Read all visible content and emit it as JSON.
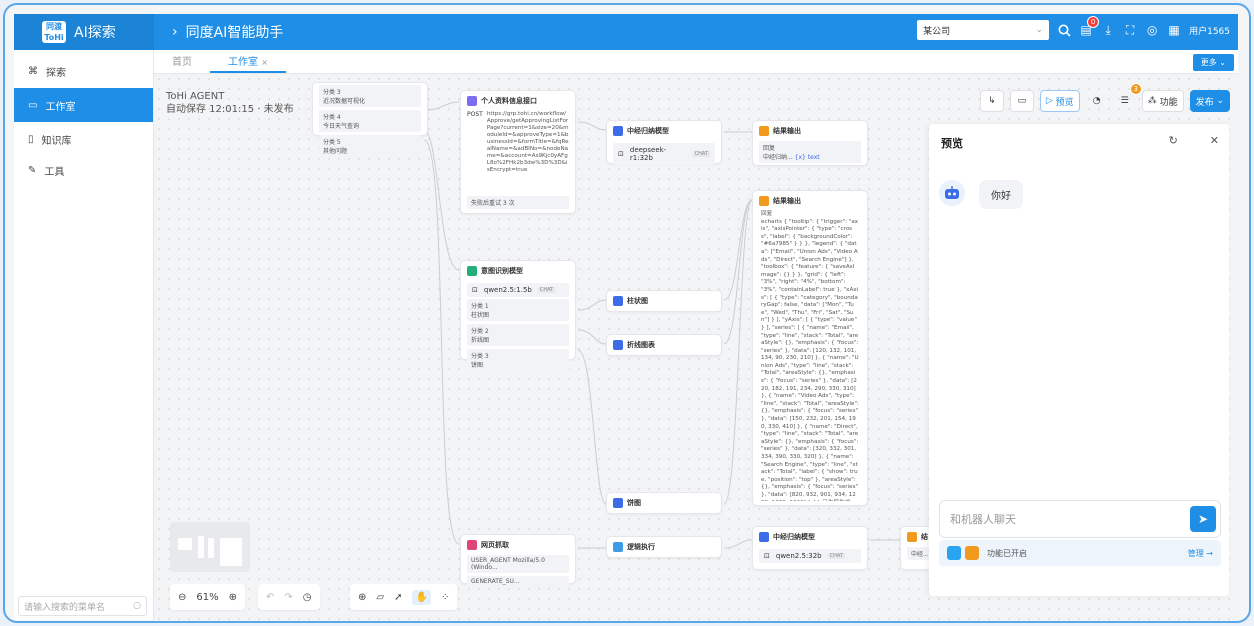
{
  "app": {
    "brand": "AI探索",
    "title": "同度AI智能助手",
    "company": "某公司",
    "user": "用户1565",
    "notif_count": "0",
    "logo_lines": [
      "同",
      "渡",
      "To",
      "Hi"
    ]
  },
  "sidebar": {
    "items": [
      {
        "label": "探索"
      },
      {
        "label": "工作室"
      },
      {
        "label": "知识库"
      },
      {
        "label": "工具"
      }
    ],
    "search_placeholder": "请输入搜索的菜单名"
  },
  "tabs": [
    {
      "label": "首页"
    },
    {
      "label": "工作室"
    }
  ],
  "tab_close": "×",
  "more_label": "更多",
  "agent": {
    "name": "ToHi AGENT",
    "status": "自动保存 12:01:15 · 未发布"
  },
  "toolbar": {
    "preview": "预览",
    "features": "功能",
    "publish": "发布",
    "alert_count": "3"
  },
  "nodes": {
    "branch_top": {
      "rows": [
        {
          "label": "分类 3",
          "value": "近况数据可视化"
        },
        {
          "label": "分类 4",
          "value": "今日天气查询"
        },
        {
          "label": "分类 5",
          "value": "其他问题"
        }
      ]
    },
    "http": {
      "title": "个人资料信息接口",
      "method": "POST",
      "url": "https://grp.tohi.cn/workflow/Approve/getApprovingListForPage?current=1&size=20&moduleId=&approveType=1&businessId=&formTitle=&fqRealName=&adBINo=&nodeName=&account=As9Kjc0yAFgL8o%2FHk2b3dw%3D%3D&isEncrypt=true",
      "retry": "失败后重试 3 次"
    },
    "llm1": {
      "title": "中经归纳模型",
      "model": "deepseek-r1:32b",
      "tag": "CHAT"
    },
    "out1": {
      "title": "结果输出",
      "label": "回复",
      "value": "中经归纳...",
      "var": "{x} text"
    },
    "intent": {
      "title": "意图识别模型",
      "model": "qwen2.5:1.5b",
      "tag": "CHAT",
      "rows": [
        {
          "label": "分类 1",
          "value": "柱状图"
        },
        {
          "label": "分类 2",
          "value": "折线图"
        },
        {
          "label": "分类 3",
          "value": "饼图"
        }
      ]
    },
    "bar": {
      "title": "柱状图"
    },
    "line": {
      "title": "折线图表"
    },
    "pie": {
      "title": "饼图"
    },
    "out2": {
      "title": "结果输出",
      "label": "回复",
      "text": "echarts { \"tooltip\": { \"trigger\": \"axis\", \"axisPointer\": { \"type\": \"cross\", \"label\": { \"backgroundColor\": \"#6a7985\" } } }, \"legend\": { \"data\": [\"Email\", \"Union Ads\", \"Video Ads\", \"Direct\", \"Search Engine\"] }, \"toolbox\": { \"feature\": { \"saveAsImage\": {} } }, \"grid\": { \"left\": \"3%\", \"right\": \"4%\", \"bottom\": \"3%\", \"containLabel\": true }, \"xAxis\": [ { \"type\": \"category\", \"boundaryGap\": false, \"data\": [\"Mon\", \"Tue\", \"Wed\", \"Thu\", \"Fri\", \"Sat\", \"Sun\"] } ], \"yAxis\": [ { \"type\": \"value\" } ], \"series\": [ { \"name\": \"Email\", \"type\": \"line\", \"stack\": \"Total\", \"areaStyle\": {}, \"emphasis\": { \"focus\": \"series\" }, \"data\": [120, 132, 101, 134, 90, 230, 210] }, { \"name\": \"Union Ads\", \"type\": \"line\", \"stack\": \"Total\", \"areaStyle\": {}, \"emphasis\": { \"focus\": \"series\" }, \"data\": [220, 182, 191, 234, 290, 330, 310] }, { \"name\": \"Video Ads\", \"type\": \"line\", \"stack\": \"Total\", \"areaStyle\": {}, \"emphasis\": { \"focus\": \"series\" }, \"data\": [150, 232, 201, 154, 190, 330, 410] }, { \"name\": \"Direct\", \"type\": \"line\", \"stack\": \"Total\", \"areaStyle\": {}, \"emphasis\": { \"focus\": \"series\" }, \"data\": [320, 332, 301, 334, 390, 330, 320] }, { \"name\": \"Search Engine\", \"type\": \"line\", \"stack\": \"Total\", \"label\": { \"show\": true, \"position\": \"top\" }, \"areaStyle\": {}, \"emphasis\": { \"focus\": \"series\" }, \"data\": [820, 932, 901, 934, 1290, 1330, 1320] } ] } 已为您生成一个echart图表。"
    },
    "webfetch": {
      "title": "网页抓取",
      "params": [
        "USER_AGENT Mozilla/5.0 (Windo...",
        "GENERATE_SU..."
      ]
    },
    "logic": {
      "title": "逻辑执行"
    },
    "llm2": {
      "title": "中经归纳模型",
      "model": "qwen2.5:32b",
      "tag": "CHAT"
    },
    "out3": {
      "title": "结",
      "value": "中经..."
    }
  },
  "zoom": "61%",
  "preview": {
    "title": "预览",
    "greeting": "你好",
    "input_placeholder": "和机器人聊天",
    "feature_status": "功能已开启",
    "manage": "管理"
  }
}
